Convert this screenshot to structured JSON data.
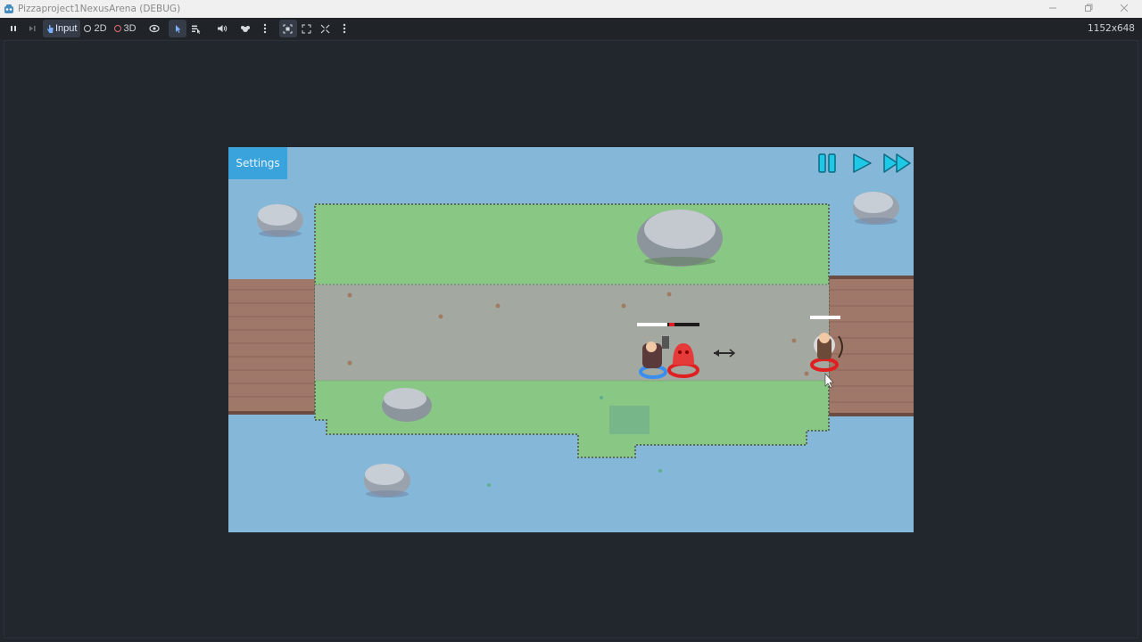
{
  "window": {
    "title": "Pizzaproject1NexusArena (DEBUG)",
    "controls": [
      "minimize-icon",
      "restore-icon",
      "close-icon"
    ]
  },
  "toolbar": {
    "pause_icon": "pause-icon",
    "next_frame_icon": "next-frame-icon",
    "input_label": "Input",
    "mode_2d_label": "2D",
    "mode_3d_label": "3D",
    "resolution": "1152x648"
  },
  "game": {
    "settings_label": "Settings",
    "controls": [
      "pause-icon",
      "play-icon",
      "fast-forward-icon"
    ],
    "colors": {
      "water": "#85b7d8",
      "grass": "#88c884",
      "path": "#a3a8a0",
      "bridge": "#9f786a",
      "accent": "#3aa3dc",
      "controls": "#1ec8e6"
    }
  }
}
